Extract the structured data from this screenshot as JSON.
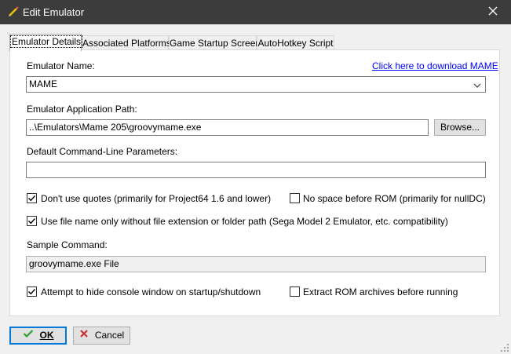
{
  "window": {
    "title": "Edit Emulator",
    "icon": "pencil-icon",
    "close_icon": "close-icon"
  },
  "tabs": [
    {
      "label": "Emulator Details",
      "active": true
    },
    {
      "label": "Associated Platforms",
      "active": false
    },
    {
      "label": "Game Startup Screen",
      "active": false
    },
    {
      "label": "AutoHotkey Script",
      "active": false
    }
  ],
  "form": {
    "emulator_name_label": "Emulator Name:",
    "download_link": "Click here to download MAME",
    "emulator_name_value": "MAME",
    "app_path_label": "Emulator Application Path:",
    "app_path_value": "..\\Emulators\\Mame 205\\groovymame.exe",
    "browse_label": "Browse...",
    "params_label": "Default Command-Line Parameters:",
    "params_value": "",
    "no_quotes_label": "Don't use quotes (primarily for Project64 1.6 and lower)",
    "no_quotes_checked": true,
    "no_space_label": "No space before ROM (primarily for nullDC)",
    "no_space_checked": false,
    "file_name_only_label": "Use file name only without file extension or folder path (Sega Model 2 Emulator, etc. compatibility)",
    "file_name_only_checked": true,
    "sample_label": "Sample Command:",
    "sample_value": "groovymame.exe File",
    "hide_console_label": "Attempt to hide console window on startup/shutdown",
    "hide_console_checked": true,
    "extract_label": "Extract ROM archives before running",
    "extract_checked": false
  },
  "footer": {
    "ok_label": "OK",
    "cancel_label": "Cancel",
    "ok_icon": "checkmark-icon",
    "cancel_icon": "x-icon"
  },
  "colors": {
    "titlebar": "#3c3c3c",
    "accent": "#0078d7",
    "link": "#0000ff",
    "ok_green": "#2e9e2e",
    "cancel_red": "#cc2a2a"
  }
}
